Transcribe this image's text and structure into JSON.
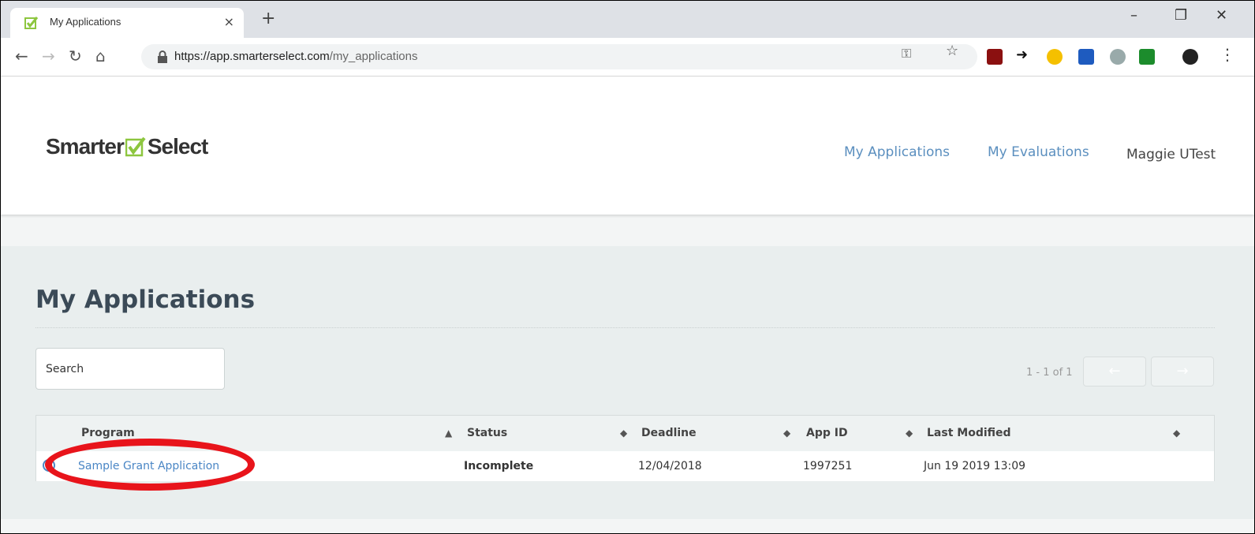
{
  "browser": {
    "tab_title": "My Applications",
    "tab_close": "×",
    "new_tab": "+",
    "url_host": "https://app.smarterselect.com",
    "url_path": "/my_applications",
    "window_controls": {
      "minimize": "–",
      "restore": "❐",
      "close": "✕"
    }
  },
  "site": {
    "logo_left": "Smarter",
    "logo_right": "Select",
    "nav": {
      "applications": "My Applications",
      "evaluations": "My Evaluations",
      "user": "Maggie UTest"
    }
  },
  "page": {
    "title": "My Applications",
    "search_placeholder": "Search",
    "pager_info": "1 - 1 of 1",
    "prev": "←",
    "next": "→"
  },
  "table": {
    "headers": {
      "program": "Program",
      "status": "Status",
      "deadline": "Deadline",
      "app_id": "App ID",
      "last_modified": "Last Modified"
    },
    "rows": [
      {
        "program": "Sample Grant Application",
        "status": "Incomplete",
        "deadline": "12/04/2018",
        "app_id": "1997251",
        "last_modified": "Jun 19 2019 13:09"
      }
    ]
  },
  "colors": {
    "link": "#5b8fbf",
    "brand_green": "#8dc63f",
    "highlight": "#e8141b"
  },
  "icons": [
    "favicon-check-icon",
    "back-arrow-icon",
    "forward-arrow-icon",
    "reload-icon",
    "home-icon",
    "lock-icon",
    "key-icon",
    "star-icon",
    "extension-icon",
    "profile-avatar-icon",
    "menu-icon"
  ]
}
